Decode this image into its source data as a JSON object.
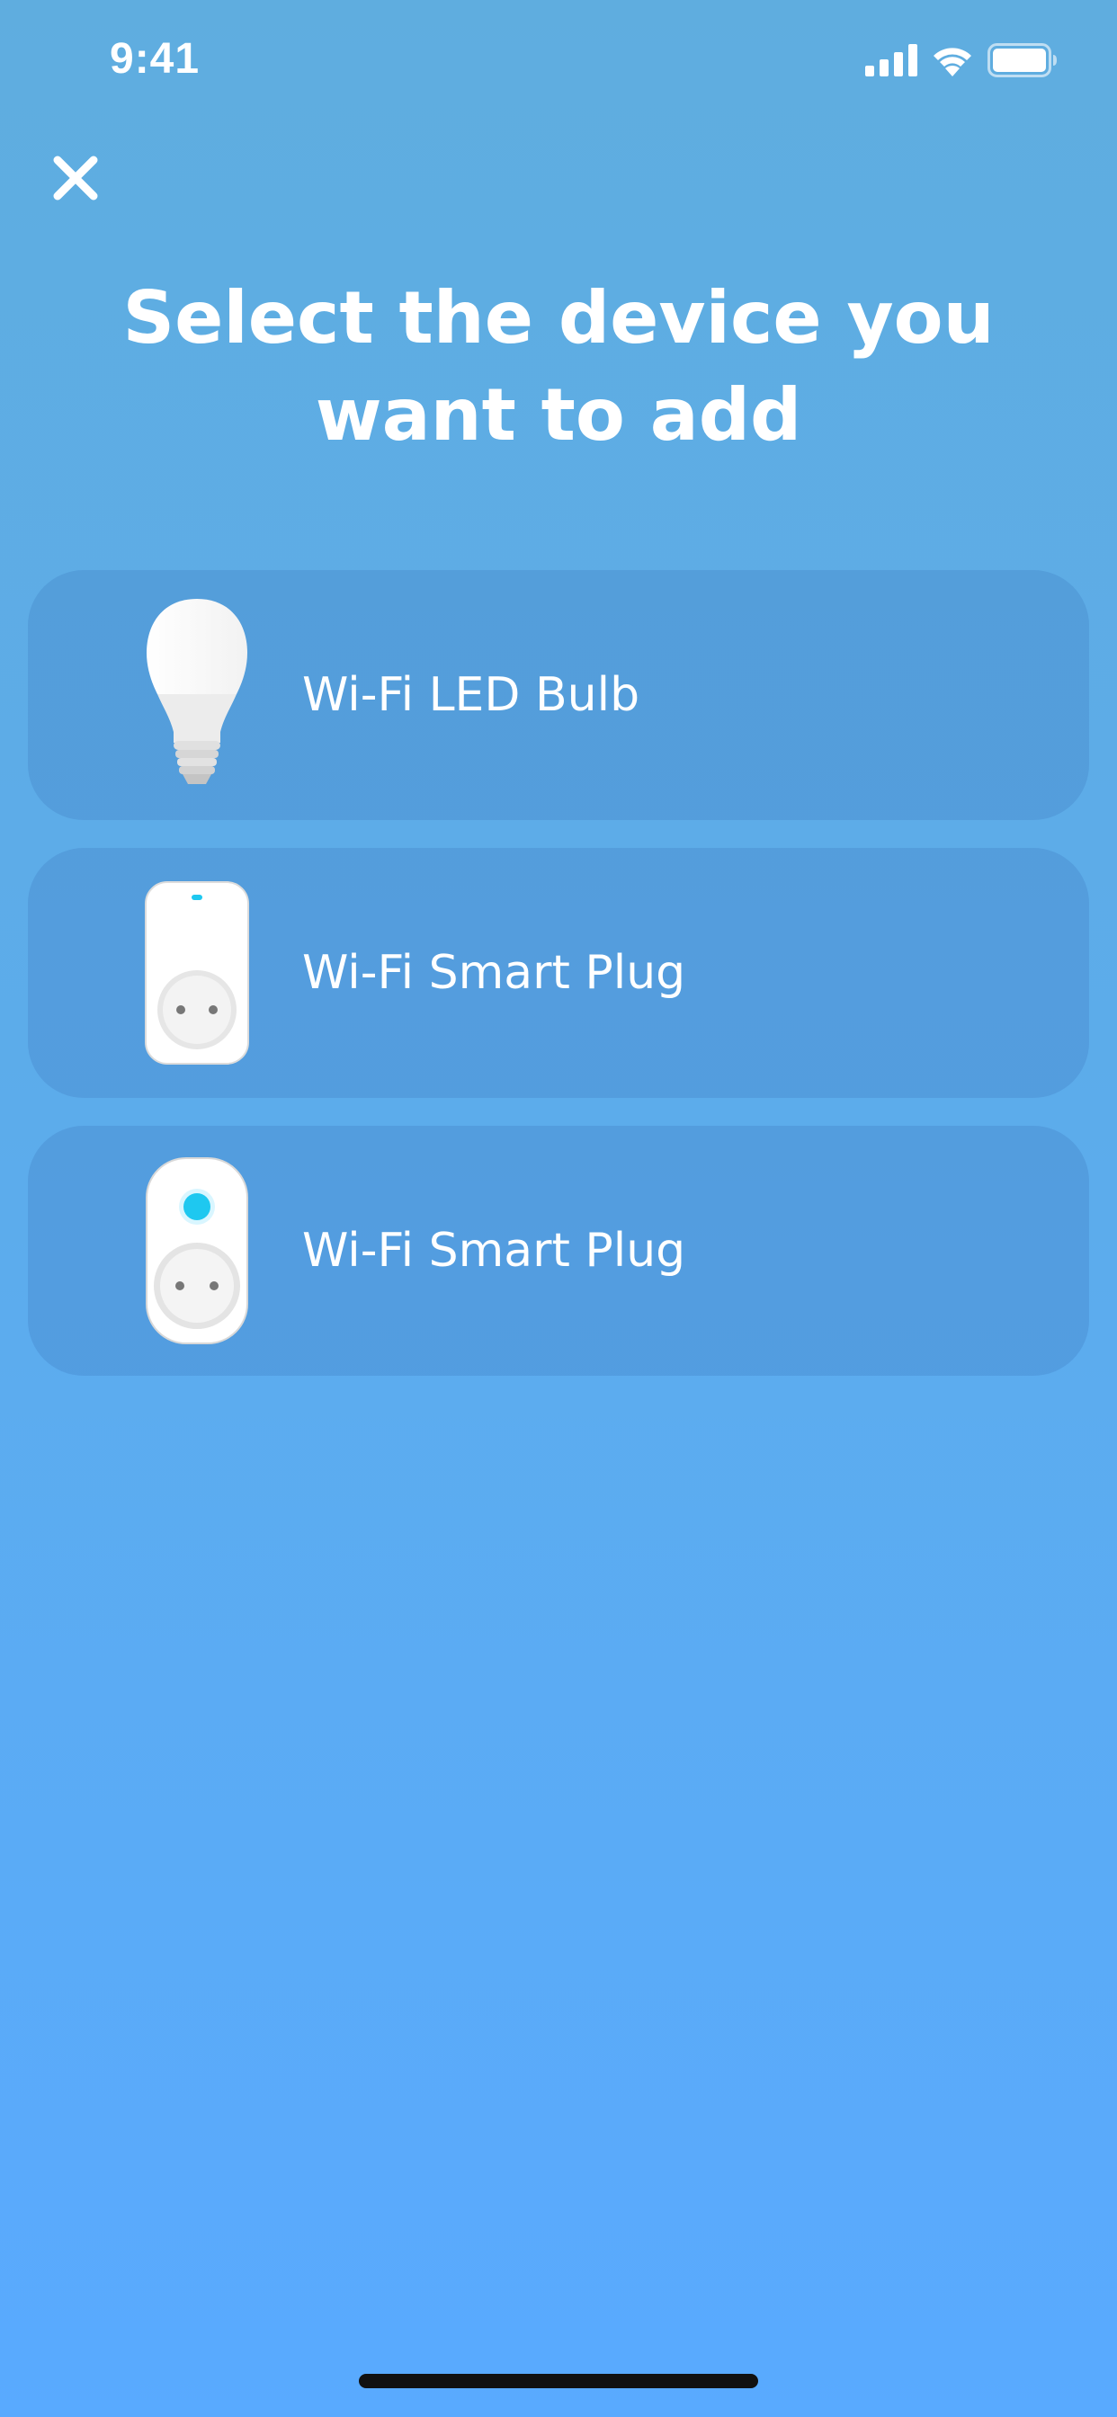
{
  "status_bar": {
    "time": "9:41",
    "icons": [
      "cellular-signal-icon",
      "wifi-icon",
      "battery-icon"
    ]
  },
  "header": {
    "close_icon": "close-icon",
    "title": "Select the device you want to add"
  },
  "devices": [
    {
      "label": "Wi-Fi LED Bulb",
      "icon": "led-bulb-icon"
    },
    {
      "label": "Wi-Fi Smart Plug",
      "icon": "smart-plug-icon"
    },
    {
      "label": "Wi-Fi Smart Plug",
      "icon": "smart-plug-round-icon"
    }
  ],
  "colors": {
    "background_top": "#5faddf",
    "background_bottom": "#59aaff",
    "text": "#ffffff",
    "indicator_led": "#1ec8f0"
  }
}
